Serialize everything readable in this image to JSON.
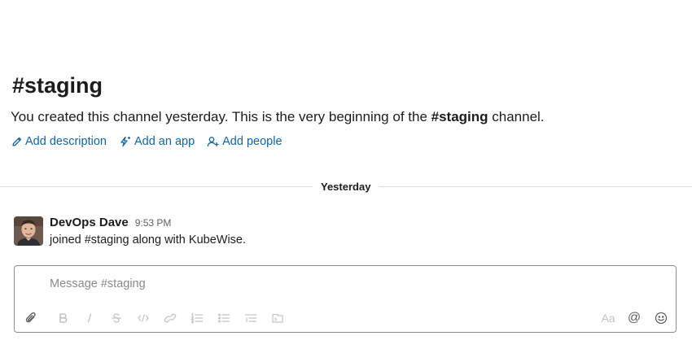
{
  "channel": {
    "title_hash": "#",
    "title_name": "staging",
    "intro_prefix": "You created this channel yesterday. This is the very beginning of the ",
    "intro_channel": "#staging",
    "intro_suffix": " channel."
  },
  "actions": {
    "add_description": "Add description",
    "add_app": "Add an app",
    "add_people": "Add people"
  },
  "divider": {
    "label": "Yesterday"
  },
  "messages": [
    {
      "sender": "DevOps Dave",
      "time": "9:53 PM",
      "text": "joined #staging along with KubeWise."
    }
  ],
  "composer": {
    "placeholder": "Message #staging",
    "format_label": "Aa",
    "mention_label": "@"
  },
  "colors": {
    "link": "#1264a3",
    "text": "#1d1c1d",
    "muted": "#616061",
    "disabled_icon": "#c4c4c4"
  }
}
